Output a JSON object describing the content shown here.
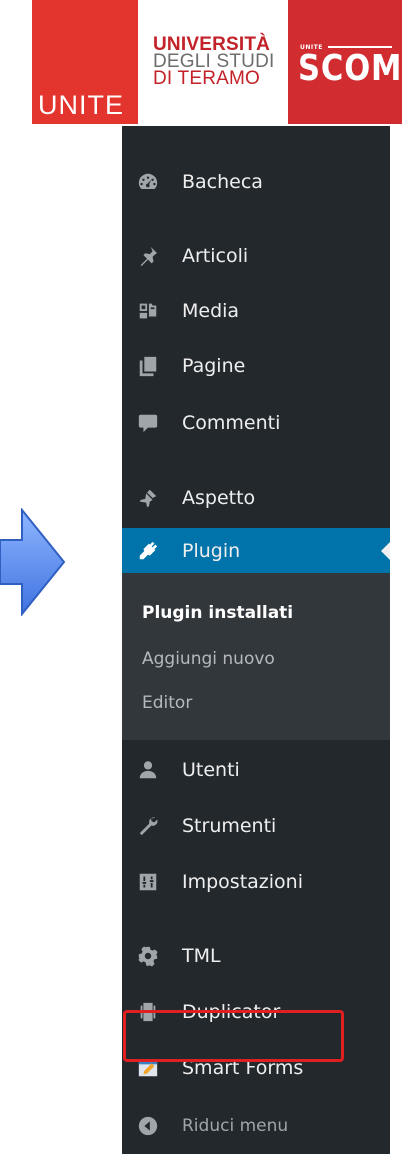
{
  "header": {
    "unite_logo": "UNITE",
    "university_line1": "UNIVERSITÀ",
    "university_line2": "DEGLI STUDI",
    "university_line3": "DI TERAMO",
    "scom_small": "UNITE",
    "scom_big": "SCOM"
  },
  "sidebar": {
    "items": [
      {
        "label": "Bacheca",
        "icon": "dashboard-icon"
      },
      {
        "label": "Articoli",
        "icon": "pin-icon"
      },
      {
        "label": "Media",
        "icon": "media-icon"
      },
      {
        "label": "Pagine",
        "icon": "pages-icon"
      },
      {
        "label": "Commenti",
        "icon": "comments-icon"
      },
      {
        "label": "Aspetto",
        "icon": "appearance-icon"
      },
      {
        "label": "Plugin",
        "icon": "plugin-icon"
      },
      {
        "label": "Utenti",
        "icon": "users-icon"
      },
      {
        "label": "Strumenti",
        "icon": "tools-icon"
      },
      {
        "label": "Impostazioni",
        "icon": "settings-icon"
      },
      {
        "label": "TML",
        "icon": "gear-icon"
      },
      {
        "label": "Duplicator",
        "icon": "duplicator-icon"
      },
      {
        "label": "Smart Forms",
        "icon": "smart-forms-icon"
      }
    ],
    "submenu": {
      "installed": "Plugin installati",
      "add_new": "Aggiungi nuovo",
      "editor": "Editor"
    },
    "collapse_label": "Riduci menu"
  },
  "colors": {
    "sidebar_bg": "#23282d",
    "submenu_bg": "#32373c",
    "active_bg": "#0073aa",
    "highlight": "#e02020",
    "arrow_fill": "#5b8ff0"
  }
}
